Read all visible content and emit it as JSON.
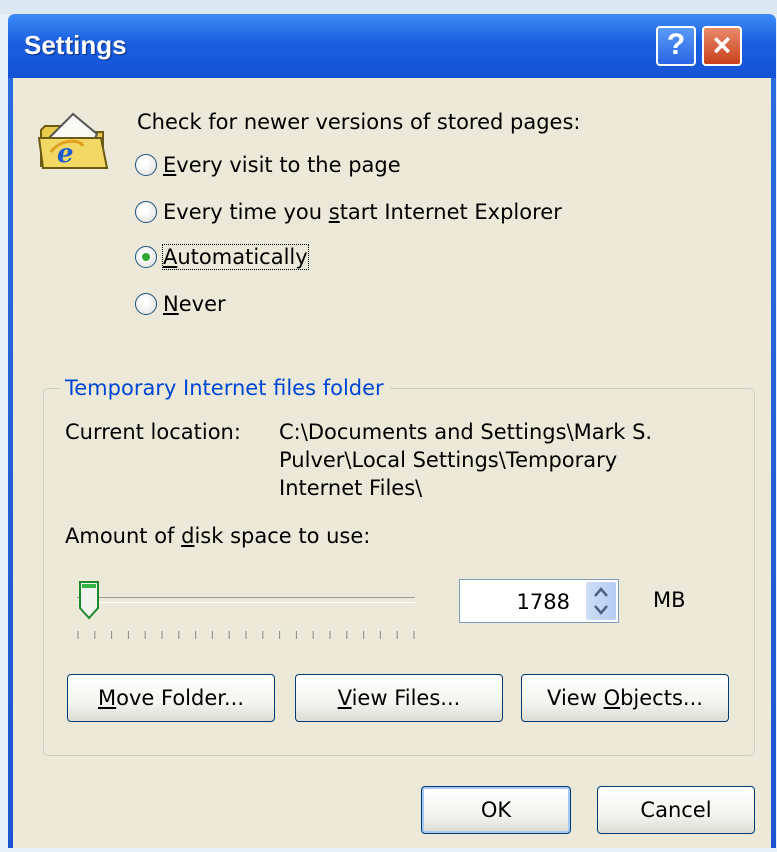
{
  "window": {
    "title": "Settings",
    "help_glyph": "?",
    "close_glyph": "×"
  },
  "check": {
    "heading": "Check for newer versions of stored pages:",
    "options": [
      {
        "mnemonic": "E",
        "rest": "very visit to the page",
        "selected": false
      },
      {
        "pre": "Every time you ",
        "mnemonic": "s",
        "rest": "tart Internet Explorer",
        "selected": false
      },
      {
        "mnemonic": "A",
        "rest": "utomatically",
        "selected": true
      },
      {
        "mnemonic": "N",
        "rest": "ever",
        "selected": false
      }
    ]
  },
  "group": {
    "title": "Temporary Internet files folder",
    "location_label": "Current location:",
    "location_lines": [
      "C:\\Documents and Settings\\Mark S.",
      "Pulver\\Local Settings\\Temporary",
      "Internet Files\\"
    ],
    "disk_label_pre": "Amount of ",
    "disk_label_mnemonic": "d",
    "disk_label_rest": "isk space to use:",
    "disk_value": "1788",
    "disk_unit": "MB",
    "slider_fraction": 0.02,
    "buttons": [
      {
        "mnemonic": "M",
        "rest": "ove Folder..."
      },
      {
        "mnemonic": "V",
        "rest": "iew Files..."
      },
      {
        "pre": "View ",
        "mnemonic": "O",
        "rest": "bjects..."
      }
    ]
  },
  "footer": {
    "ok": "OK",
    "cancel": "Cancel"
  },
  "icons": {
    "app": "ie-folder-icon"
  },
  "colors": {
    "title_blue": "#1a5fe0",
    "group_title": "#0046d5",
    "dialog_bg": "#ece9d8"
  }
}
